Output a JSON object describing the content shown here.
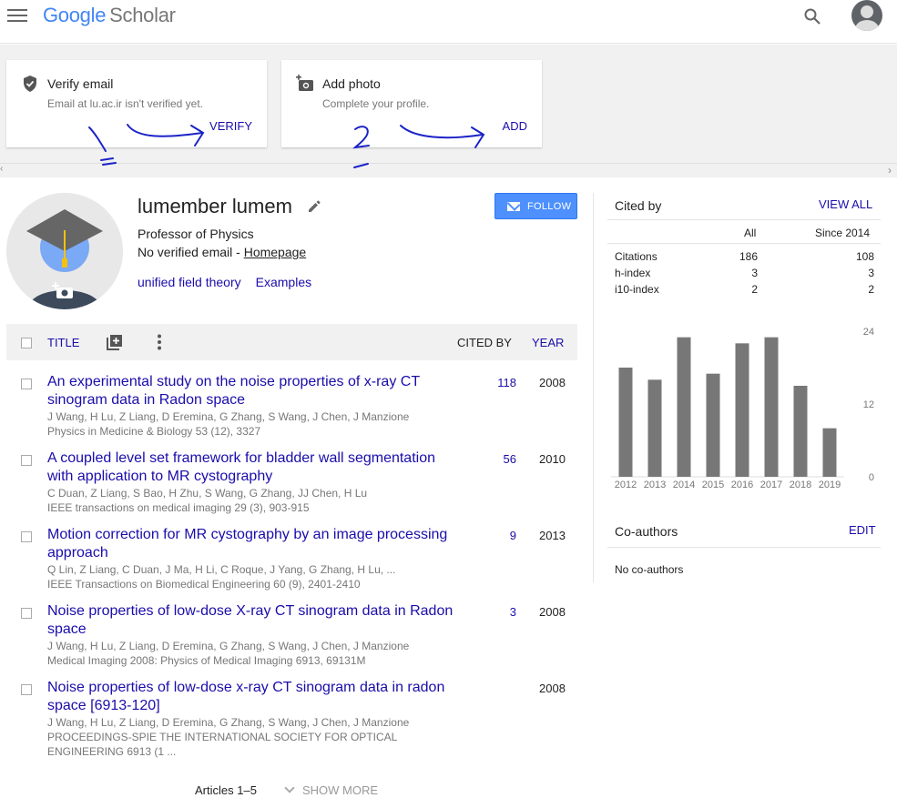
{
  "header": {
    "logo_google": "Google",
    "logo_scholar": "Scholar"
  },
  "banner": {
    "verify": {
      "title": "Verify email",
      "subtitle": "Email at lu.ac.ir isn't verified yet.",
      "action": "VERIFY"
    },
    "photo": {
      "title": "Add photo",
      "subtitle": "Complete your profile.",
      "action": "ADD"
    }
  },
  "profile": {
    "name": "lumember lumem",
    "affiliation": "Professor of Physics",
    "email_text": "No verified email - ",
    "homepage": "Homepage",
    "interests": [
      "unified field theory",
      "Examples"
    ],
    "follow_label": "FOLLOW"
  },
  "table": {
    "title_header": "TITLE",
    "cited_header": "CITED BY",
    "year_header": "YEAR"
  },
  "articles": [
    {
      "title": "An experimental study on the noise properties of x-ray CT sinogram data in Radon space",
      "authors": "J Wang, H Lu, Z Liang, D Eremina, G Zhang, S Wang, J Chen, J Manzione",
      "venue": "Physics in Medicine & Biology 53 (12), 3327",
      "cited": "118",
      "year": "2008"
    },
    {
      "title": "A coupled level set framework for bladder wall segmentation with application to MR cystography",
      "authors": "C Duan, Z Liang, S Bao, H Zhu, S Wang, G Zhang, JJ Chen, H Lu",
      "venue": "IEEE transactions on medical imaging 29 (3), 903-915",
      "cited": "56",
      "year": "2010"
    },
    {
      "title": "Motion correction for MR cystography by an image processing approach",
      "authors": "Q Lin, Z Liang, C Duan, J Ma, H Li, C Roque, J Yang, G Zhang, H Lu, ...",
      "venue": "IEEE Transactions on Biomedical Engineering 60 (9), 2401-2410",
      "cited": "9",
      "year": "2013"
    },
    {
      "title": "Noise properties of low-dose X-ray CT sinogram data in Radon space",
      "authors": "J Wang, H Lu, Z Liang, D Eremina, G Zhang, S Wang, J Chen, J Manzione",
      "venue": "Medical Imaging 2008: Physics of Medical Imaging 6913, 69131M",
      "cited": "3",
      "year": "2008"
    },
    {
      "title": "Noise properties of low-dose x-ray CT sinogram data in radon space [6913-120]",
      "authors": "J Wang, H Lu, Z Liang, D Eremina, G Zhang, S Wang, J Chen, J Manzione",
      "venue": "PROCEEDINGS-SPIE THE INTERNATIONAL SOCIETY FOR OPTICAL ENGINEERING 6913 (1 ...",
      "cited": "",
      "year": "2008"
    }
  ],
  "pager": {
    "label": "Articles 1–5",
    "show_more": "SHOW MORE"
  },
  "cited_by": {
    "title": "Cited by",
    "view_all": "VIEW ALL",
    "col_all": "All",
    "col_since": "Since 2014",
    "rows": [
      {
        "label": "Citations",
        "all": "186",
        "since": "108"
      },
      {
        "label": "h-index",
        "all": "3",
        "since": "3"
      },
      {
        "label": "i10-index",
        "all": "2",
        "since": "2"
      }
    ]
  },
  "chart_data": {
    "type": "bar",
    "categories": [
      "2012",
      "2013",
      "2014",
      "2015",
      "2016",
      "2017",
      "2018",
      "2019"
    ],
    "values": [
      18,
      16,
      23,
      17,
      22,
      23,
      15,
      8
    ],
    "yticks": [
      "0",
      "12",
      "24"
    ],
    "ylim": [
      0,
      24
    ],
    "bar_color": "#777777"
  },
  "coauthors": {
    "title": "Co-authors",
    "edit": "EDIT",
    "empty": "No co-authors"
  },
  "colors": {
    "link": "#1a0dab",
    "follow": "#4d90fe",
    "annotation_ink": "#1a22c8"
  },
  "annotations": [
    "1",
    "2"
  ]
}
